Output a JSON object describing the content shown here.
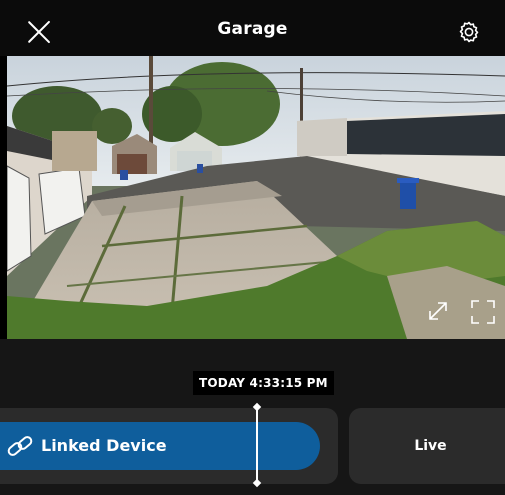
{
  "header": {
    "title": "Garage",
    "close_icon": "close-icon",
    "settings_icon": "gear-icon"
  },
  "video": {
    "expand_icon": "expand-icon",
    "fullscreen_icon": "fullscreen-icon"
  },
  "timeline": {
    "timestamp": "TODAY 4:33:15 PM",
    "linked_device_label": "Linked Device",
    "link_icon": "link-icon",
    "live_label": "Live"
  },
  "colors": {
    "background": "#161616",
    "topbar": "#0b0b0b",
    "accent": "#0f5e9c",
    "panel": "#2b2b2b"
  }
}
